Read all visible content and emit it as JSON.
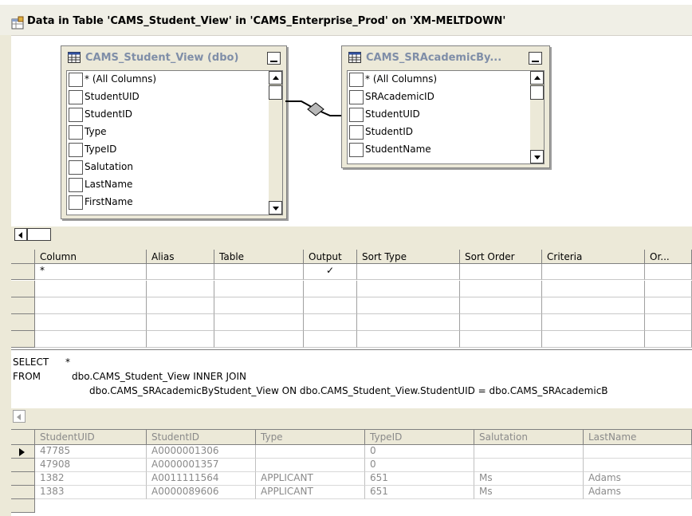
{
  "window": {
    "title": "Data in Table 'CAMS_Student_View' in 'CAMS_Enterprise_Prod' on 'XM-MELTDOWN'"
  },
  "diagram": {
    "table1": {
      "name": "CAMS_Student_View (dbo)",
      "columns": [
        "* (All Columns)",
        "StudentUID",
        "StudentID",
        "Type",
        "TypeID",
        "Salutation",
        "LastName",
        "FirstName"
      ]
    },
    "table2": {
      "name": "CAMS_SRAcademicBy...",
      "columns": [
        "* (All Columns)",
        "SRAcademicID",
        "StudentUID",
        "StudentID",
        "StudentName"
      ]
    },
    "join_icon": "inner-join-diamond-icon"
  },
  "criteria_grid": {
    "headers": [
      "Column",
      "Alias",
      "Table",
      "Output",
      "Sort Type",
      "Sort Order",
      "Criteria",
      "Or..."
    ],
    "rows": [
      {
        "column": "*",
        "alias": "",
        "table": "",
        "output": "✓",
        "sort_type": "",
        "sort_order": "",
        "criteria": "",
        "or": ""
      }
    ]
  },
  "sql": {
    "line1_kw": "SELECT",
    "line1_rest": "*",
    "line2_kw": "FROM",
    "line2_rest": "dbo.CAMS_Student_View INNER JOIN",
    "line3": "dbo.CAMS_SRAcademicByStudent_View ON dbo.CAMS_Student_View.StudentUID = dbo.CAMS_SRAcademicB"
  },
  "results": {
    "headers": [
      "StudentUID",
      "StudentID",
      "Type",
      "TypeID",
      "Salutation",
      "LastName"
    ],
    "rows": [
      [
        "47785",
        "A0000001306",
        "",
        "0",
        "",
        ""
      ],
      [
        "47908",
        "A0000001357",
        "",
        "0",
        "",
        ""
      ],
      [
        "1382",
        "A0011111564",
        "APPLICANT",
        "651",
        "Ms",
        "Adams"
      ],
      [
        "1383",
        "A0000089606",
        "APPLICANT",
        "651",
        "Ms",
        "Adams"
      ]
    ],
    "current_row": 0
  },
  "colors": {
    "chrome": "#ece9d8",
    "table_title": "#7f8ea8",
    "results_text": "#8a8a8a"
  }
}
